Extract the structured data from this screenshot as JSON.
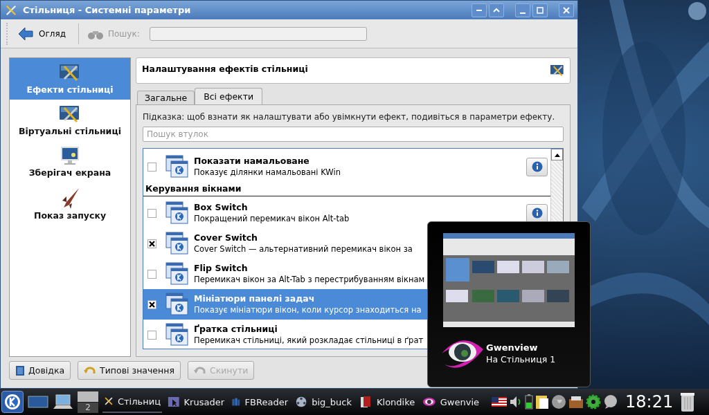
{
  "window": {
    "title": "Стільниця - Системні параметри"
  },
  "toolbar": {
    "back_label": "Огляд",
    "search_label": "Пошук:"
  },
  "sidebar": {
    "items": [
      {
        "label": "Ефекти стільниці",
        "kind": "effects",
        "selected": true
      },
      {
        "label": "Віртуальні стільниці",
        "kind": "virtual",
        "selected": false
      },
      {
        "label": "Зберігач екрана",
        "kind": "screensaver",
        "selected": false
      },
      {
        "label": "Показ запуску",
        "kind": "launch",
        "selected": false
      }
    ]
  },
  "header": {
    "title": "Налаштування ефектів стільниці"
  },
  "tabs": [
    {
      "label": "Загальне",
      "selected": false
    },
    {
      "label": "Всі ефекти",
      "selected": true
    }
  ],
  "hint": "Підказка: щоб взнати як налаштувати або увімкнути ефект, подивіться в параметри ефекту.",
  "search": {
    "placeholder": "Пошук втулок"
  },
  "effects": [
    {
      "kind": "effect",
      "name": "Показати намальоване",
      "description": "Показує ділянки намальовані KWin",
      "checked": false,
      "selected": false,
      "info_button": true
    },
    {
      "kind": "category",
      "name": "Керування вікнами"
    },
    {
      "kind": "effect",
      "name": "Box Switch",
      "description": "Покращений перемикач вікон Alt-tab",
      "checked": false,
      "selected": false,
      "info_button": true
    },
    {
      "kind": "effect",
      "name": "Cover Switch",
      "description": "Cover Switch — альтернативний перемикач вікон за",
      "checked": true,
      "selected": false,
      "info_button": false
    },
    {
      "kind": "effect",
      "name": "Flip Switch",
      "description": "Перемикач вікон за Alt-Tab з перестрибуванням вікнам",
      "checked": false,
      "selected": false,
      "info_button": false
    },
    {
      "kind": "effect",
      "name": "Мініатюри панелі задач",
      "description": "Показує мініатюри вікон, коли курсор знаходиться на",
      "checked": true,
      "selected": true,
      "info_button": false
    },
    {
      "kind": "effect",
      "name": "Ґратка стільниці",
      "description": "Перемикач стільниці, який розкладає стільниці в ґрат",
      "checked": false,
      "selected": false,
      "info_button": false
    }
  ],
  "buttons": [
    {
      "label": "Довідка",
      "kind": "help",
      "disabled": false
    },
    {
      "label": "Типові значення",
      "kind": "defaults",
      "disabled": false
    },
    {
      "label": "Скинути",
      "kind": "reset",
      "disabled": true
    }
  ],
  "popup": {
    "title": "Gwenview",
    "subtitle": "На Стільниця 1"
  },
  "taskbar": {
    "pager": [
      {
        "selected": true
      },
      {
        "label": "2",
        "selected": false
      }
    ],
    "tasks": [
      {
        "label": "Стільниц",
        "kind": "settings",
        "selected": true
      },
      {
        "label": "Krusader",
        "kind": "krusader",
        "selected": false
      },
      {
        "label": "FBReader",
        "kind": "books",
        "selected": false
      },
      {
        "label": "big_buck",
        "kind": "video",
        "selected": false
      },
      {
        "label": "Klondike",
        "kind": "cards",
        "selected": false
      },
      {
        "label": "Gwenvie",
        "kind": "eye",
        "selected": false
      }
    ],
    "clock": "18:21"
  }
}
